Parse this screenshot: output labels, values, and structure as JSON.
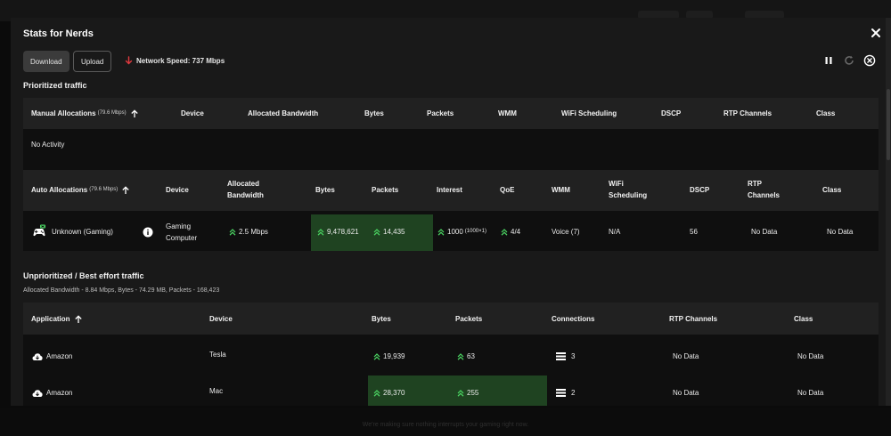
{
  "modal": {
    "title": "Stats for Nerds",
    "download_label": "Download",
    "upload_label": "Upload",
    "network_speed": "Network Speed: 737 Mbps"
  },
  "prioritized": {
    "section_title": "Prioritized traffic",
    "manual": {
      "headers": {
        "col1": "Manual Allocations",
        "col1_sub": "(79.6 Mbps)",
        "device": "Device",
        "allocated": "Allocated Bandwidth",
        "bytes": "Bytes",
        "packets": "Packets",
        "wmm": "WMM",
        "wifi": "WiFi Scheduling",
        "dscp": "DSCP",
        "rtp": "RTP Channels",
        "class": "Class"
      },
      "empty_text": "No Activity"
    },
    "auto": {
      "headers": {
        "col1": "Auto Allocations",
        "col1_sub": "(79.6 Mbps)",
        "device": "Device",
        "allocated_1": "Allocated",
        "allocated_2": "Bandwidth",
        "bytes": "Bytes",
        "packets": "Packets",
        "interest": "Interest",
        "qoe": "QoE",
        "wmm": "WMM",
        "wifi_1": "WiFi",
        "wifi_2": "Scheduling",
        "dscp": "DSCP",
        "rtp_1": "RTP",
        "rtp_2": "Channels",
        "class": "Class"
      },
      "row": {
        "name": "Unknown (Gaming)",
        "device_1": "Gaming",
        "device_2": "Computer",
        "bandwidth": "2.5 Mbps",
        "bytes": "9,478,621",
        "packets": "14,435",
        "interest": "1000",
        "interest_sub": "(1000×1)",
        "qoe": "4/4",
        "wmm": "Voice (7)",
        "wifi": "N/A",
        "dscp": "56",
        "rtp": "No Data",
        "class": "No Data"
      }
    }
  },
  "unprioritized": {
    "section_title": "Unprioritized / Best effort traffic",
    "summary": "Allocated Bandwidth - 8.84 Mbps, Bytes - 74.29 MB, Packets - 168,423",
    "headers": {
      "application": "Application",
      "device": "Device",
      "bytes": "Bytes",
      "packets": "Packets",
      "connections": "Connections",
      "rtp": "RTP Channels",
      "class": "Class"
    },
    "rows": [
      {
        "app": "Amazon",
        "device": "Tesla",
        "bytes": "19,939",
        "packets": "63",
        "connections": "3",
        "rtp": "No Data",
        "class": "No Data"
      },
      {
        "app": "Amazon",
        "device": "Mac",
        "bytes": "28,370",
        "packets": "255",
        "connections": "2",
        "rtp": "No Data",
        "class": "No Data"
      }
    ]
  },
  "background": {
    "footer_hint": "We're making sure nothing interrupts your gaming right now."
  },
  "colors": {
    "accent_green": "#4cd964",
    "highlight_bg": "#1f4321",
    "arrow_red": "#e0393e"
  },
  "icons": [
    "close-icon",
    "download-arrow-icon",
    "pause-icon",
    "refresh-icon",
    "stop-circle-icon",
    "sort-up-arrow-icon",
    "gamepad-icon",
    "info-icon",
    "cloud-icon",
    "list-icon",
    "double-chevron-up-icon"
  ]
}
